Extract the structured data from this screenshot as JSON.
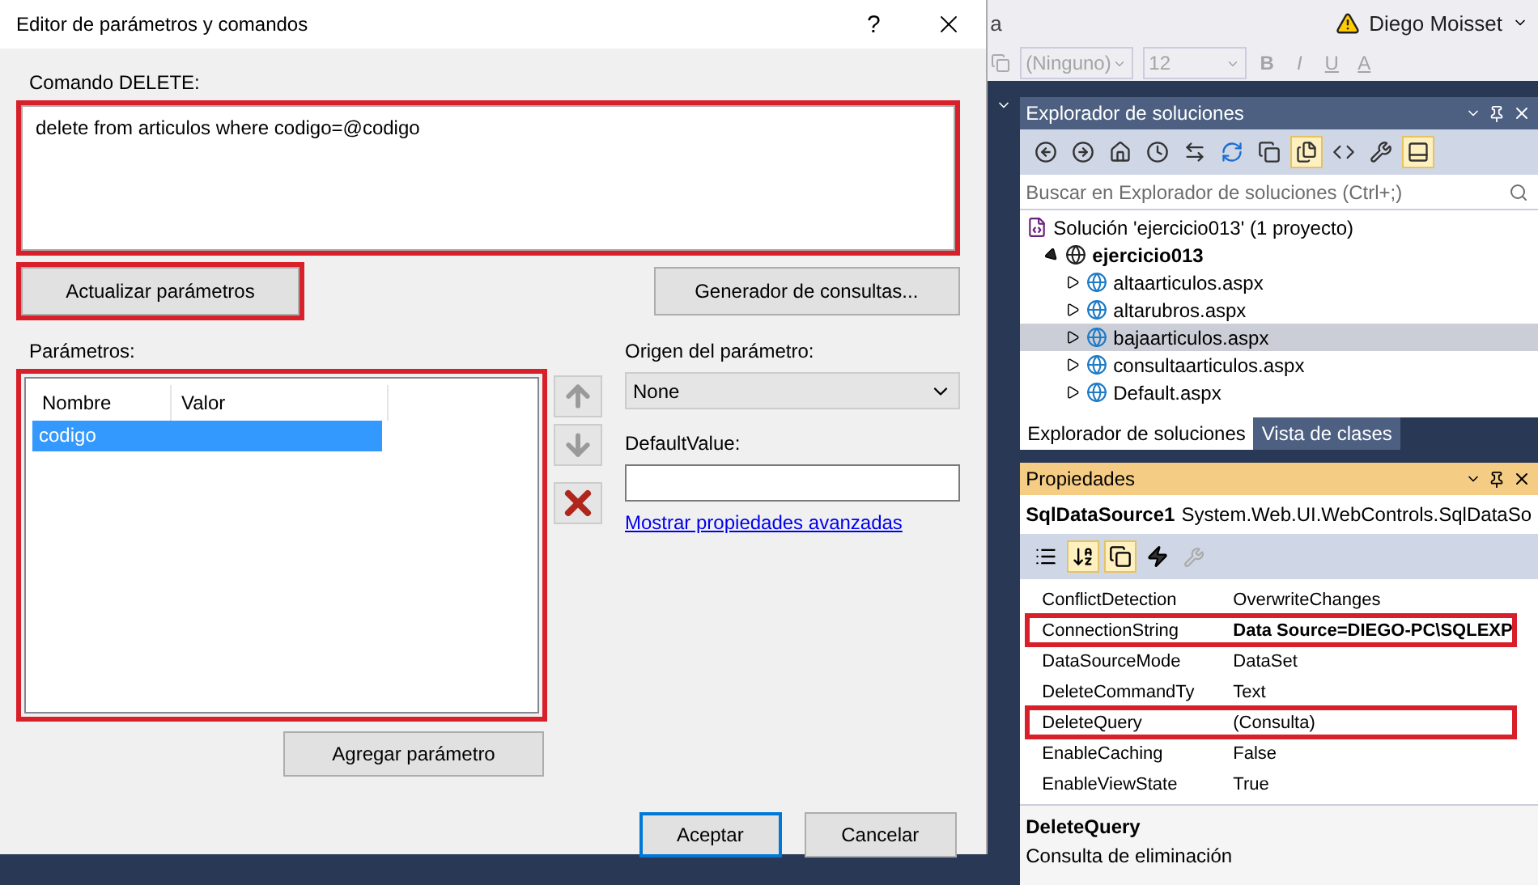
{
  "dialog": {
    "title": "Editor de parámetros y comandos",
    "help_button": "?",
    "command_label": "Comando DELETE:",
    "command_text": "delete from articulos where codigo=@codigo",
    "command_highlighted": true,
    "refresh_button": {
      "label": "Actualizar parámetros",
      "highlighted": true
    },
    "query_builder_button": "Generador de consultas...",
    "parameters_label": "Parámetros:",
    "parameters_highlighted": true,
    "columns": [
      "Nombre",
      "Valor"
    ],
    "parameters": [
      {
        "name": "codigo",
        "selected": true
      }
    ],
    "add_button": "Agregar parámetro",
    "source_label": "Origen del parámetro:",
    "source_value": "None",
    "default_label": "DefaultValue:",
    "advanced_link": "Mostrar propiedades avanzadas",
    "ok_button": "Aceptar",
    "cancel_button": "Cancelar"
  },
  "ide": {
    "menu_fragment": "a",
    "user": "Diego Moisset",
    "font_name": "(Ninguno)",
    "font_size": "12",
    "format_buttons": [
      "B",
      "I",
      "U",
      "A"
    ],
    "solution_explorer": {
      "title": "Explorador de soluciones",
      "search_placeholder": "Buscar en Explorador de soluciones (Ctrl+;)",
      "tools": [
        {
          "kind": "back",
          "on": false
        },
        {
          "kind": "forward",
          "on": false
        },
        {
          "kind": "home",
          "on": false
        },
        {
          "kind": "history",
          "on": false
        },
        {
          "kind": "sync",
          "on": false
        },
        {
          "kind": "refresh",
          "on": false
        },
        {
          "kind": "collapse",
          "on": false
        },
        {
          "kind": "files",
          "on": true
        },
        {
          "kind": "code",
          "on": false
        },
        {
          "kind": "wrench",
          "on": false
        },
        {
          "kind": "preview",
          "on": true
        }
      ],
      "tree": [
        {
          "label": "Solución 'ejercicio013'  (1 proyecto)",
          "kind": "solution",
          "children": [
            {
              "label": "ejercicio013",
              "kind": "project",
              "expanded": true,
              "children": [
                {
                  "label": "altaarticulos.aspx",
                  "kind": "file",
                  "selected": false
                },
                {
                  "label": "altarubros.aspx",
                  "kind": "file",
                  "selected": false
                },
                {
                  "label": "bajaarticulos.aspx",
                  "kind": "file",
                  "selected": true
                },
                {
                  "label": "consultaarticulos.aspx",
                  "kind": "file",
                  "selected": false
                },
                {
                  "label": "Default.aspx",
                  "kind": "file",
                  "selected": false
                }
              ]
            }
          ]
        }
      ],
      "tabs": [
        {
          "label": "Explorador de soluciones",
          "selected": true
        },
        {
          "label": "Vista de clases",
          "selected": false
        }
      ]
    },
    "properties": {
      "title": "Propiedades",
      "object_name": "SqlDataSource1",
      "object_type": "System.Web.UI.WebControls.SqlDataSo",
      "rows": [
        {
          "name": "ConflictDetection",
          "value": "OverwriteChanges",
          "bold": false,
          "highlighted": false
        },
        {
          "name": "ConnectionString",
          "value": "Data Source=DIEGO-PC\\SQLEXP",
          "bold": true,
          "highlighted": true
        },
        {
          "name": "DataSourceMode",
          "value": "DataSet",
          "bold": false,
          "highlighted": false
        },
        {
          "name": "DeleteCommandTy",
          "value": "Text",
          "bold": false,
          "highlighted": false
        },
        {
          "name": "DeleteQuery",
          "value": "(Consulta)",
          "bold": false,
          "highlighted": true
        },
        {
          "name": "EnableCaching",
          "value": "False",
          "bold": false,
          "highlighted": false
        },
        {
          "name": "EnableViewState",
          "value": "True",
          "bold": false,
          "highlighted": false
        }
      ],
      "description_title": "DeleteQuery",
      "description": "Consulta de eliminación"
    }
  }
}
